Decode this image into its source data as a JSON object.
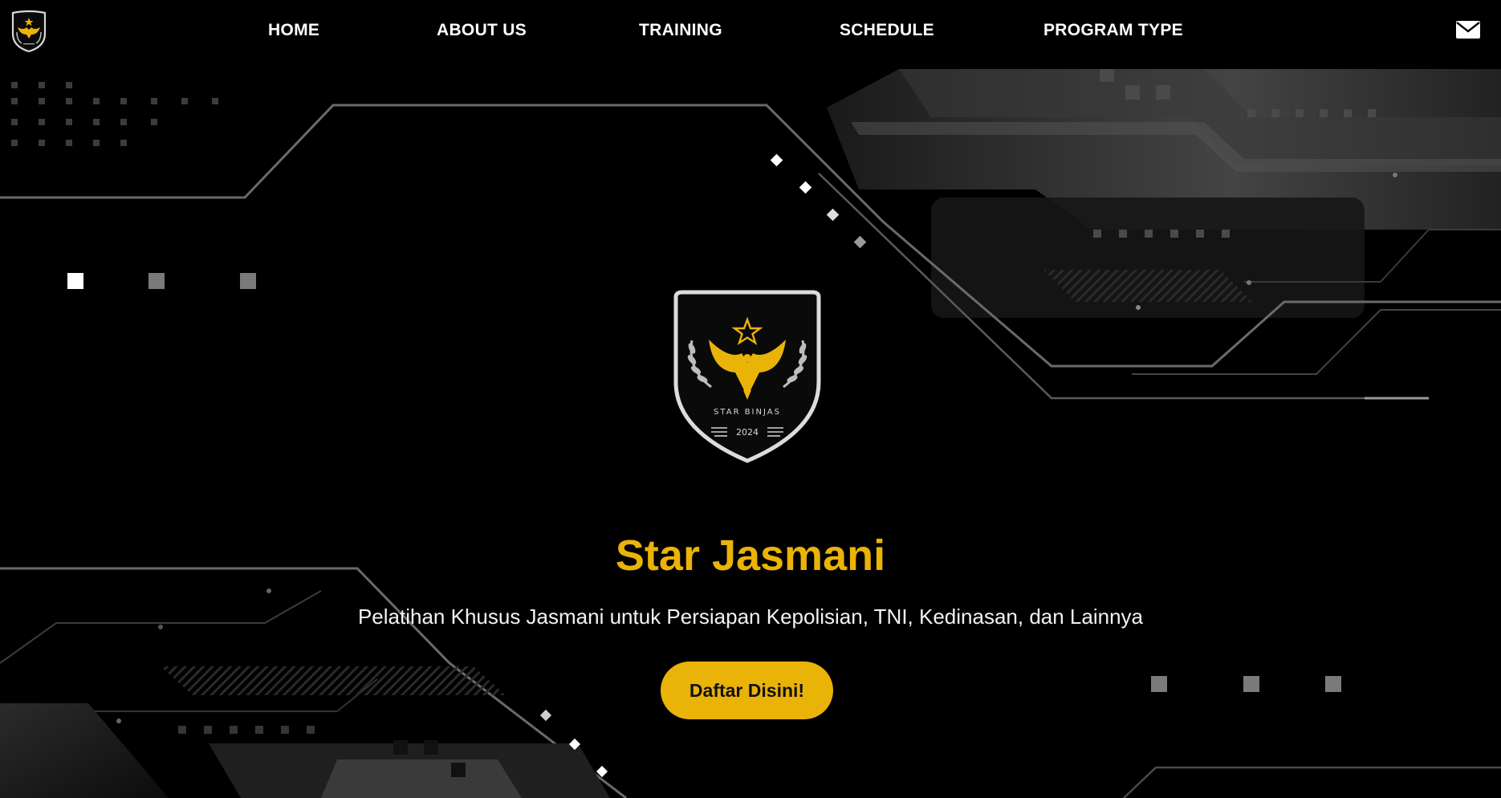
{
  "nav": {
    "logo_icon": "star-binjas-emblem-icon",
    "links": [
      {
        "label": "HOME"
      },
      {
        "label": "ABOUT US"
      },
      {
        "label": "TRAINING"
      },
      {
        "label": "SCHEDULE"
      },
      {
        "label": "PROGRAM TYPE"
      }
    ],
    "mail_icon": "envelope-icon"
  },
  "hero": {
    "emblem": {
      "icon": "eagle-star-shield-icon",
      "text": "STAR BINJAS",
      "year": "2024"
    },
    "title": "Star Jasmani",
    "subtitle": "Pelatihan Khusus Jasmani untuk Persiapan Kepolisian, TNI, Kedinasan, dan Lainnya",
    "cta_label": "Daftar Disini!"
  },
  "colors": {
    "accent": "#eab308",
    "background": "#000000",
    "text": "#ffffff"
  }
}
